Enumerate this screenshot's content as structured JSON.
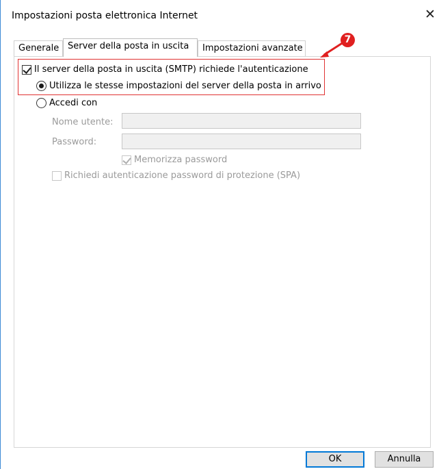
{
  "window": {
    "title": "Impostazioni posta elettronica Internet",
    "close_glyph": "✕"
  },
  "tabs": [
    {
      "label": "Generale",
      "active": false
    },
    {
      "label": "Server della posta in uscita",
      "active": true
    },
    {
      "label": "Impostazioni avanzate",
      "active": false
    }
  ],
  "outgoing": {
    "smtp_auth_label": "Il server della posta in uscita (SMTP) richiede l'autenticazione",
    "smtp_auth_checked": true,
    "use_same_label": "Utilizza le stesse impostazioni del server della posta in arrivo",
    "use_same_selected": true,
    "login_with_label": "Accedi con",
    "login_with_selected": false,
    "username_label": "Nome utente:",
    "username_value": "",
    "password_label": "Password:",
    "password_value": "",
    "remember_label": "Memorizza password",
    "remember_checked": true,
    "spa_label": "Richiedi autenticazione password di protezione (SPA)",
    "spa_checked": false
  },
  "annotation": {
    "callout_number": "7",
    "color": "#e02020"
  },
  "buttons": {
    "ok": "OK",
    "cancel": "Annulla"
  },
  "colors": {
    "window_border": "#3c8ad6",
    "default_button_border": "#0078d7",
    "button_bg": "#e1e1e1"
  }
}
